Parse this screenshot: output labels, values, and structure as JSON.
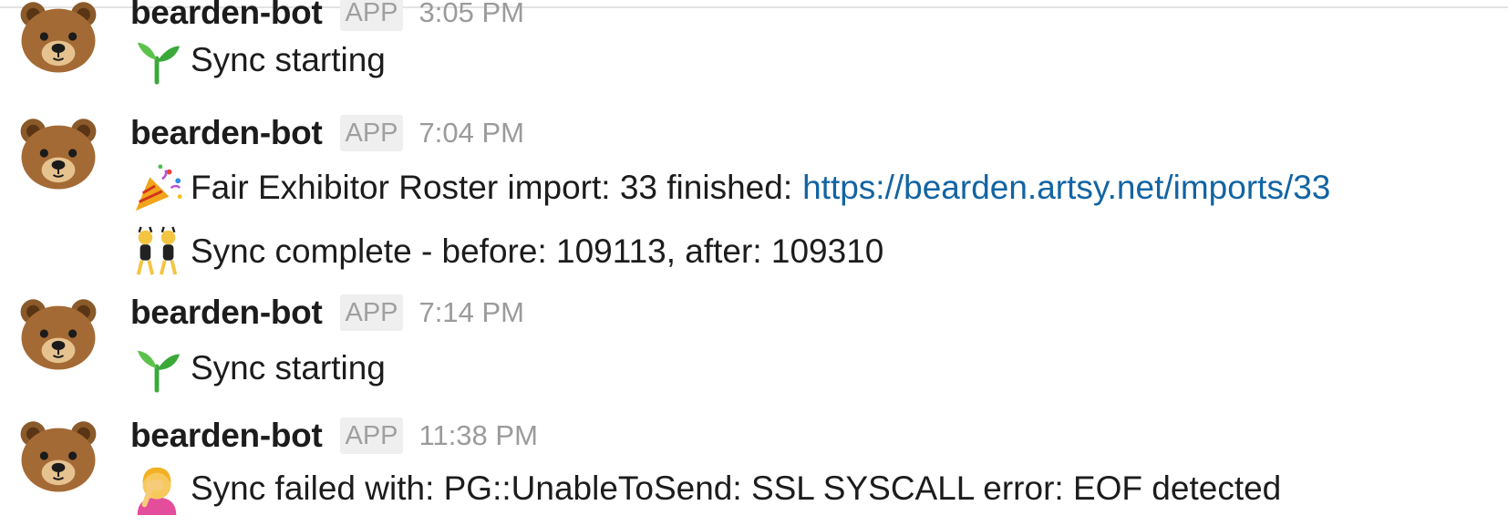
{
  "messages": [
    {
      "sender": "bearden-bot",
      "badge": "APP",
      "time": "3:05 PM",
      "lines": [
        {
          "emoji": "seedling",
          "text": "Sync starting"
        }
      ]
    },
    {
      "sender": "bearden-bot",
      "badge": "APP",
      "time": "7:04 PM",
      "lines": [
        {
          "emoji": "party-popper",
          "text": "Fair Exhibitor Roster import: 33 finished:",
          "link": "https://bearden.artsy.net/imports/33"
        },
        {
          "emoji": "dancers",
          "text": "Sync complete - before: 109113, after: 109310"
        }
      ]
    },
    {
      "sender": "bearden-bot",
      "badge": "APP",
      "time": "7:14 PM",
      "lines": [
        {
          "emoji": "seedling",
          "text": "Sync starting"
        }
      ]
    },
    {
      "sender": "bearden-bot",
      "badge": "APP",
      "time": "11:38 PM",
      "lines": [
        {
          "emoji": "face-palm",
          "text": "Sync failed with: PG::UnableToSend: SSL SYSCALL error: EOF detected"
        }
      ]
    }
  ],
  "avatar_icon": "bear-face",
  "colors": {
    "link": "#1264a3",
    "timestamp": "#9b9b9b",
    "badge_bg": "#efefef",
    "badge_text": "#a0a0a0",
    "sender": "#1d1c1d"
  }
}
